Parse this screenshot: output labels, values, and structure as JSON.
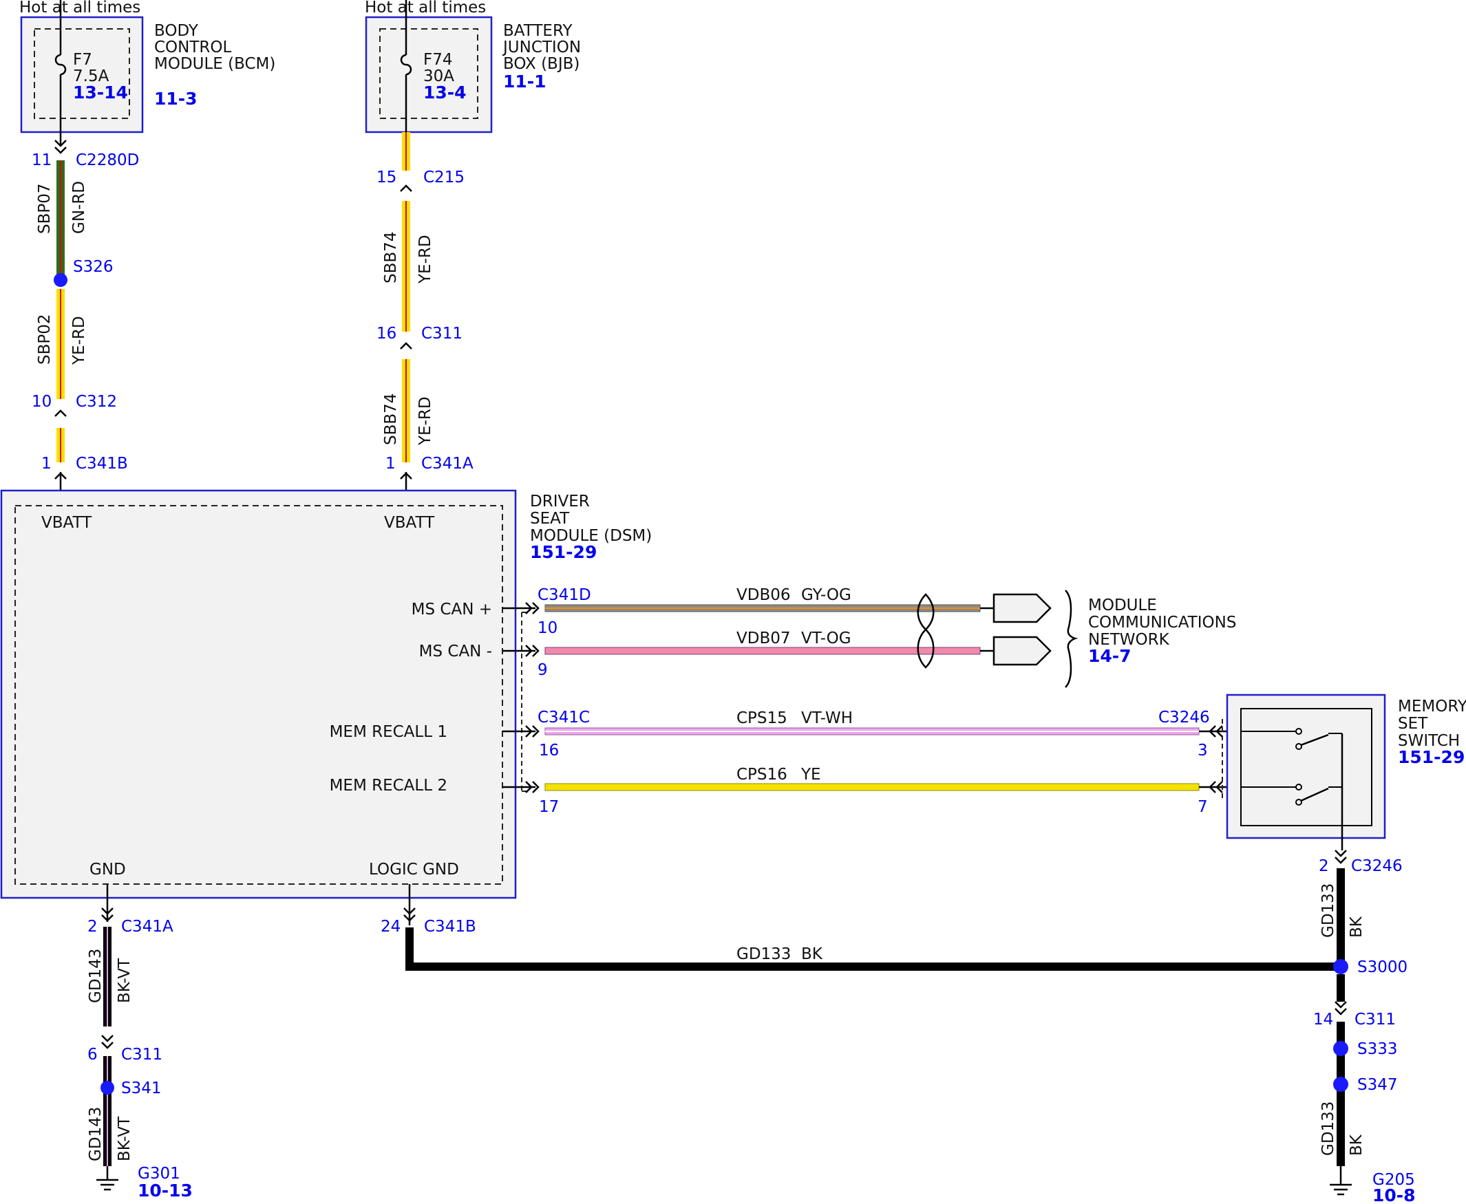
{
  "colors": {
    "box_border": "#1f1fcc",
    "box_fill": "#f2f2f2",
    "label_blue": "#0000ee",
    "splice_dot": "#1a1aff",
    "wire_ye": "#f5e100",
    "wire_rd": "#e00000",
    "wire_gn": "#2e6b1f",
    "wire_bk": "#000000",
    "wire_gy": "#8a8a8a",
    "wire_og": "#ff8c00",
    "wire_vt": "#e6a0e6",
    "wire_wh": "#ffffff",
    "can_minus_fill": "#f08aa8",
    "mem1_fill": "#eaa6ea"
  },
  "bcm": {
    "hot_label": "Hot at all times",
    "name_line1": "BODY",
    "name_line2": "CONTROL",
    "name_line3": "MODULE (BCM)",
    "fuse_id": "F7",
    "fuse_rating": "7.5A",
    "fuse_ref": "13-14",
    "page_ref": "11-3"
  },
  "bjb": {
    "hot_label": "Hot at all times",
    "name_line1": "BATTERY",
    "name_line2": "JUNCTION",
    "name_line3": "BOX (BJB)",
    "fuse_id": "F74",
    "fuse_rating": "30A",
    "fuse_ref": "13-4",
    "page_ref": "11-1"
  },
  "left_feed": {
    "c2280d_pin": "11",
    "c2280d": "C2280D",
    "wire1_circuit": "SBP07",
    "wire1_color": "GN-RD",
    "splice1": "S326",
    "wire2_circuit": "SBP02",
    "wire2_color": "YE-RD",
    "c312_pin": "10",
    "c312": "C312",
    "c341b_pin": "1",
    "c341b": "C341B"
  },
  "mid_feed": {
    "c215_pin": "15",
    "c215": "C215",
    "wire1_circuit": "SBB74",
    "wire1_color": "YE-RD",
    "c311_pin": "16",
    "c311": "C311",
    "wire2_circuit": "SBB74",
    "wire2_color": "YE-RD",
    "c341a_pin": "1",
    "c341a": "C341A"
  },
  "dsm": {
    "name_line1": "DRIVER",
    "name_line2": "SEAT",
    "name_line3": "MODULE (DSM)",
    "page_ref": "151-29",
    "vbatt1": "VBATT",
    "vbatt2": "VBATT",
    "ms_can_plus": "MS CAN +",
    "ms_can_minus": "MS CAN -",
    "mem_recall1": "MEM RECALL 1",
    "mem_recall2": "MEM RECALL 2",
    "gnd": "GND",
    "logic_gnd": "LOGIC GND"
  },
  "can": {
    "connector": "C341D",
    "plus_pin": "10",
    "plus_circuit": "VDB06",
    "plus_color": "GY-OG",
    "minus_pin": "9",
    "minus_circuit": "VDB07",
    "minus_color": "VT-OG",
    "network_line1": "MODULE",
    "network_line2": "COMMUNICATIONS",
    "network_line3": "NETWORK",
    "network_ref": "14-7"
  },
  "mem": {
    "connector_left": "C341C",
    "connector_right": "C3246",
    "r1_pin_left": "16",
    "r1_circuit": "CPS15",
    "r1_color": "VT-WH",
    "r1_pin_right": "3",
    "r2_pin_left": "17",
    "r2_circuit": "CPS16",
    "r2_color": "YE",
    "r2_pin_right": "7",
    "switch_line1": "MEMORY",
    "switch_line2": "SET",
    "switch_line3": "SWITCH",
    "switch_ref": "151-29"
  },
  "left_ground": {
    "c341a_pin": "2",
    "c341a": "C341A",
    "wire1_circuit": "GD143",
    "wire1_color": "BK-VT",
    "c311_pin": "6",
    "c311": "C311",
    "splice": "S341",
    "wire2_circuit": "GD143",
    "wire2_color": "BK-VT",
    "ground": "G301",
    "ground_ref": "10-13"
  },
  "logic_ground": {
    "c341b_pin": "24",
    "c341b": "C341B",
    "wire_circuit": "GD133",
    "wire_color": "BK"
  },
  "right_ground": {
    "c3246_pin": "2",
    "c3246": "C3246",
    "wire1_circuit": "GD133",
    "wire1_color": "BK",
    "splice1": "S3000",
    "c311_pin": "14",
    "c311": "C311",
    "splice2": "S333",
    "splice3": "S347",
    "wire2_circuit": "GD133",
    "wire2_color": "BK",
    "ground": "G205",
    "ground_ref": "10-8"
  }
}
